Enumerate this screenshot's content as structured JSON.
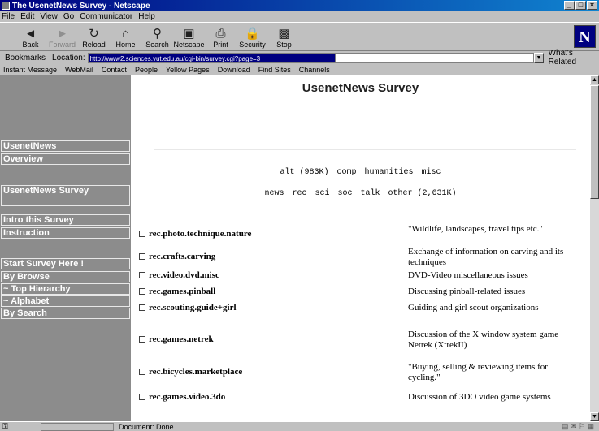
{
  "window": {
    "title": "The UsenetNews Survey - Netscape"
  },
  "menu": [
    "File",
    "Edit",
    "View",
    "Go",
    "Communicator",
    "Help"
  ],
  "toolbar": [
    {
      "label": "Back",
      "icon": "back-arrow-icon",
      "glyph": "◄",
      "disabled": false
    },
    {
      "label": "Forward",
      "icon": "forward-arrow-icon",
      "glyph": "►",
      "disabled": true
    },
    {
      "label": "Reload",
      "icon": "reload-icon",
      "glyph": "↻",
      "disabled": false
    },
    {
      "label": "Home",
      "icon": "home-icon",
      "glyph": "⌂",
      "disabled": false
    },
    {
      "label": "Search",
      "icon": "search-icon",
      "glyph": "⚲",
      "disabled": false
    },
    {
      "label": "Netscape",
      "icon": "netscape-icon",
      "glyph": "▣",
      "disabled": false
    },
    {
      "label": "Print",
      "icon": "print-icon",
      "glyph": "⎙",
      "disabled": false
    },
    {
      "label": "Security",
      "icon": "security-lock-icon",
      "glyph": "🔒",
      "disabled": false
    },
    {
      "label": "Stop",
      "icon": "stop-icon",
      "glyph": "▩",
      "disabled": false
    }
  ],
  "location": {
    "bookmarks_label": "Bookmarks",
    "location_label": "Location:",
    "url": "http://www2.sciences.vut.edu.au/cgi-bin/survey.cgi?page=3",
    "related_label": "What's Related"
  },
  "personal_toolbar": [
    "Instant Message",
    "WebMail",
    "Contact",
    "People",
    "Yellow Pages",
    "Download",
    "Find Sites",
    "Channels"
  ],
  "sidebar": {
    "items": [
      {
        "label": "UsenetNews"
      },
      {
        "label": "Overview"
      },
      {
        "label": "UsenetNews Survey"
      },
      {
        "label": "Intro this Survey"
      },
      {
        "label": "Instruction"
      },
      {
        "label": "Start Survey Here !"
      },
      {
        "label": "By Browse"
      },
      {
        "label": "~ Top Hierarchy"
      },
      {
        "label": "~ Alphabet"
      },
      {
        "label": "By Search"
      }
    ]
  },
  "main": {
    "title": "UsenetNews Survey",
    "categories_row1": [
      "alt (983K)",
      "comp",
      "humanities",
      "misc"
    ],
    "categories_row2": [
      "news",
      "rec",
      "sci",
      "soc",
      "talk",
      "other (2,631K)"
    ],
    "groups": [
      {
        "name": "rec.photo.technique.nature",
        "description": "\"Wildlife, landscapes, travel tips etc.\""
      },
      {
        "name": "rec.crafts.carving",
        "description": "Exchange of information on carving and its techniques"
      },
      {
        "name": "rec.video.dvd.misc",
        "description": "DVD-Video miscellaneous issues"
      },
      {
        "name": "rec.games.pinball",
        "description": "Discussing pinball-related issues"
      },
      {
        "name": "rec.scouting.guide+girl",
        "description": "Guiding and girl scout organizations"
      },
      {
        "name": "rec.games.netrek",
        "description": "Discussion of the X window system game Netrek (XtrekII)"
      },
      {
        "name": "rec.bicycles.marketplace",
        "description": "\"Buying, selling & reviewing items for cycling.\""
      },
      {
        "name": "rec.games.video.3do",
        "description": "Discussion of 3DO video game systems"
      }
    ]
  },
  "status": {
    "text": "Document: Done"
  }
}
